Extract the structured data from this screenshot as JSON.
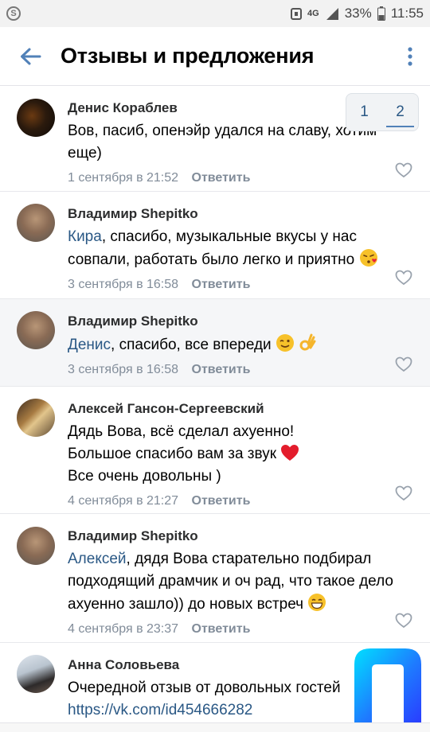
{
  "status_bar": {
    "network": "4G",
    "battery": "33%",
    "time": "11:55"
  },
  "header": {
    "title": "Отзывы и предложения"
  },
  "pager": {
    "pages": [
      "1",
      "2"
    ],
    "current": "2"
  },
  "actions": {
    "reply_label": "Ответить"
  },
  "comments": [
    {
      "author": "Денис Кораблев",
      "text": "Вов, пасиб, опенэйр удался на славу, хотим еще)",
      "date": "1 сентября в 21:52"
    },
    {
      "author": "Владимир Shepitko",
      "mention": "Кира",
      "text": ", спасибо, музыкальные вкусы у нас совпали, работать было легко и приятно",
      "date": "3 сентября в 16:58"
    },
    {
      "author": "Владимир Shepitko",
      "mention": "Денис",
      "text": ", спасибо, все впереди",
      "date": "3 сентября в 16:58"
    },
    {
      "author": "Алексей Гансон-Сергеевский",
      "line1": "Дядь Вова, всё сделал ахуенно!",
      "line2": "Большое спасибо вам за звук",
      "line3": "Все очень довольны )",
      "date": "4 сентября в 21:27"
    },
    {
      "author": "Владимир Shepitko",
      "mention": "Алексей",
      "text": ", дядя Вова старательно подбирал подходящий драмчик и оч рад, что такое дело ахуенно зашло)) до новых встреч",
      "date": "4 сентября в 23:37"
    },
    {
      "author": "Анна Соловьева",
      "text": "Очередной отзыв от довольных гостей",
      "link": "https://vk.com/id454666282"
    }
  ],
  "colors": {
    "accent": "#5181b8",
    "link": "#2a5885",
    "meta": "#818c99",
    "alt_row": "#f5f6f8"
  }
}
